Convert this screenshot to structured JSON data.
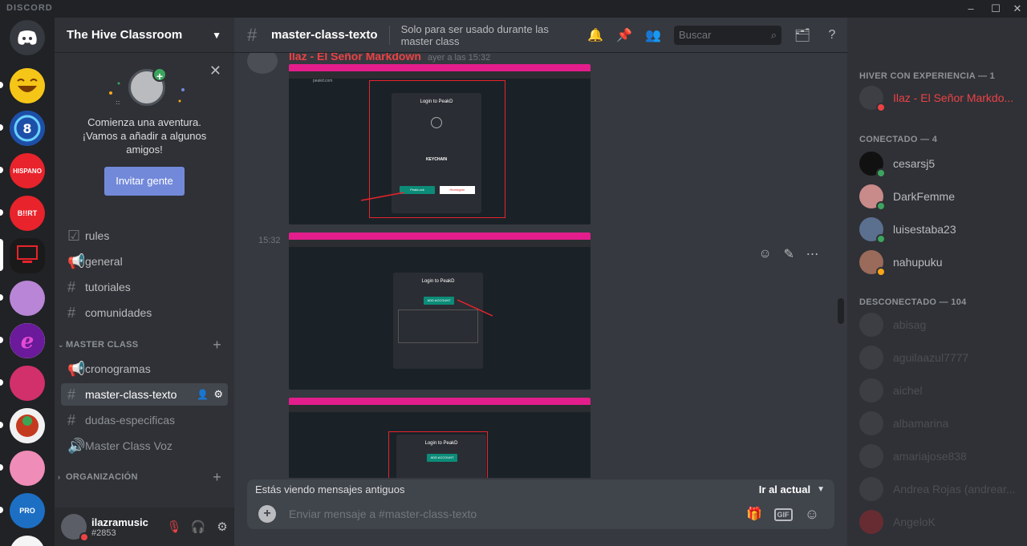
{
  "app": {
    "brand": "DISCORD"
  },
  "colors": {
    "accent": "#7289da",
    "online": "#3ba55d",
    "dnd": "#ed4245",
    "owner_name": "#ed4245"
  },
  "guild": {
    "name": "The Hive Classroom"
  },
  "invite": {
    "message": "Comienza una aventura. ¡Vamos a añadir a algunos amigos!",
    "button": "Invitar gente"
  },
  "channels": {
    "top": [
      {
        "label": "rules",
        "icon": "rules-icon"
      },
      {
        "label": "general",
        "icon": "announcement-icon"
      },
      {
        "label": "tutoriales",
        "icon": "hash-icon"
      },
      {
        "label": "comunidades",
        "icon": "hash-icon"
      }
    ],
    "cat_master": "MASTER CLASS",
    "master": [
      {
        "label": "cronogramas",
        "icon": "announcement-icon"
      },
      {
        "label": "master-class-texto",
        "icon": "hash-icon"
      },
      {
        "label": "dudas-especificas",
        "icon": "hash-icon"
      },
      {
        "label": "Master Class Voz",
        "icon": "voice-icon"
      }
    ],
    "cat_org": "ORGANIZACIÓN"
  },
  "user": {
    "name": "ilazramusic",
    "disc": "#2853"
  },
  "header": {
    "channel": "master-class-texto",
    "topic": "Solo para ser usado durante las master class",
    "search_placeholder": "Buscar"
  },
  "message": {
    "author": "Ilaz - El Señor Markdown",
    "timestamp": "ayer a las 15:32",
    "side_timestamp": "15:32"
  },
  "screens": {
    "dialog_title": "Login to PeakD",
    "url": "peakd.com",
    "keychain": "KEYCHAIN",
    "peaklock": "PeakLock",
    "hivesigner": "Hivesigner",
    "add_account": "ADD ACCOUNT"
  },
  "banner": {
    "text": "Estás viendo mensajes antiguos",
    "action": "Ir al actual"
  },
  "composer": {
    "placeholder": "Enviar mensaje a #master-class-texto",
    "gif": "GIF"
  },
  "members": {
    "group1": "HIVER CON EXPERIENCIA — 1",
    "group1_members": [
      "Ilaz - El Señor Markdo..."
    ],
    "group2": "CONECTADO — 4",
    "group2_members": [
      "cesarsj5",
      "DarkFemme",
      "luisestaba23",
      "nahupuku"
    ],
    "group3": "DESCONECTADO — 104",
    "group3_members": [
      "abisag",
      "aguilaazul7777",
      "aichel",
      "albamarina",
      "amariajose838",
      "Andrea Rojas (andrear...",
      "AngeloK"
    ]
  },
  "guild_labels": [
    "HISPANO",
    "B!!RT",
    "PRO"
  ]
}
